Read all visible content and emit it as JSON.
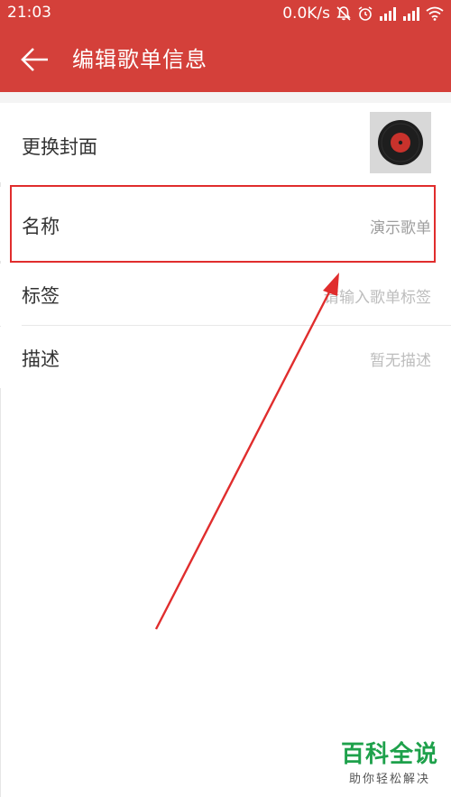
{
  "status_bar": {
    "time": "21:03",
    "net_speed": "0.0K/s",
    "icons": [
      "mute-bell-icon",
      "alarm-icon",
      "signal-icon",
      "signal-icon",
      "wifi-icon"
    ]
  },
  "app_bar": {
    "back_icon": "arrow-left-icon",
    "title": "编辑歌单信息"
  },
  "rows": {
    "cover": {
      "label": "更换封面",
      "thumb_icon": "vinyl-record-icon"
    },
    "name": {
      "label": "名称",
      "value": "演示歌单"
    },
    "tags": {
      "label": "标签",
      "placeholder": "请输入歌单标签"
    },
    "description": {
      "label": "描述",
      "placeholder": "暂无描述"
    }
  },
  "annotation": {
    "highlight_color": "#e02d2d"
  },
  "watermark": {
    "title": "百科全说",
    "subtitle": "助你轻松解决"
  },
  "colors": {
    "accent": "#d4403a",
    "label_text": "#333333",
    "hint_text": "#9e9e9e"
  }
}
